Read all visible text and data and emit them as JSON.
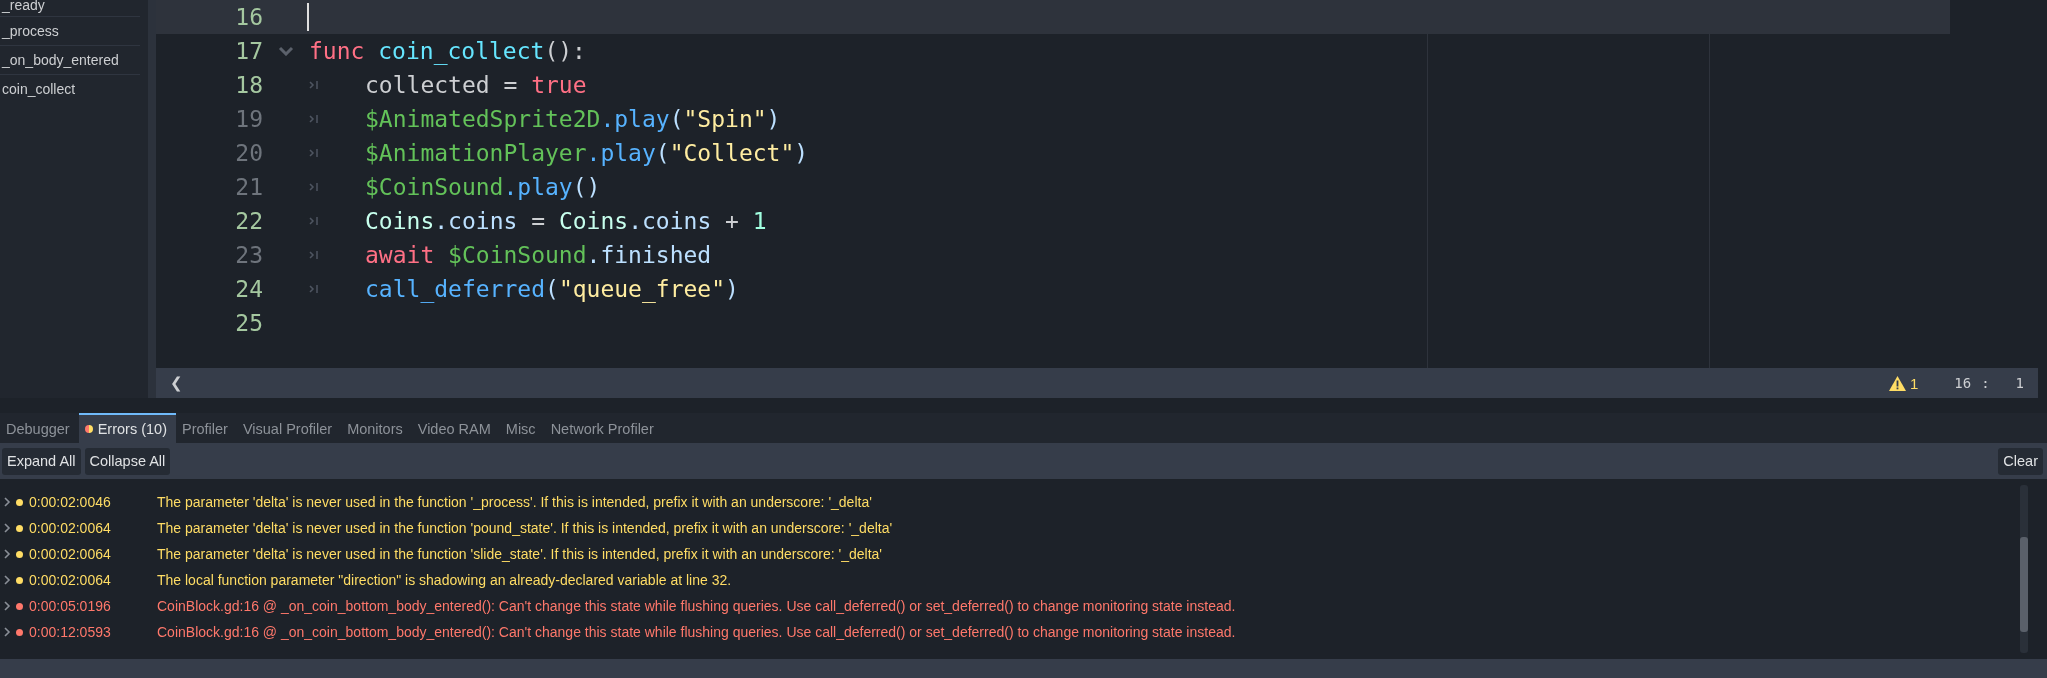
{
  "sidebar": {
    "items": [
      {
        "label": "_ready",
        "selected": false
      },
      {
        "label": "_process",
        "selected": false
      },
      {
        "label": "_on_body_entered",
        "selected": false
      },
      {
        "label": "coin_collect",
        "selected": false
      }
    ]
  },
  "editor": {
    "lines": [
      {
        "number": "16",
        "current": true,
        "highlighted_number": true,
        "foldable": false,
        "indent": false
      },
      {
        "number": "17",
        "current": false,
        "highlighted_number": true,
        "foldable": true,
        "indent": false,
        "tokens": [
          {
            "kind": "keyword",
            "text": "func "
          },
          {
            "kind": "function",
            "text": "coin_collect"
          },
          {
            "kind": "plain",
            "text": "():"
          }
        ]
      },
      {
        "number": "18",
        "current": false,
        "highlighted_number": true,
        "foldable": false,
        "indent": true,
        "tokens": [
          {
            "kind": "plain",
            "text": "collected = "
          },
          {
            "kind": "keyword",
            "text": "true"
          }
        ]
      },
      {
        "number": "19",
        "current": false,
        "highlighted_number": false,
        "foldable": false,
        "indent": true,
        "tokens": [
          {
            "kind": "node",
            "text": "$AnimatedSprite2D"
          },
          {
            "kind": "method",
            "text": ".play"
          },
          {
            "kind": "member",
            "text": "("
          },
          {
            "kind": "string",
            "text": "\"Spin\""
          },
          {
            "kind": "member",
            "text": ")"
          }
        ]
      },
      {
        "number": "20",
        "current": false,
        "highlighted_number": false,
        "foldable": false,
        "indent": true,
        "tokens": [
          {
            "kind": "node",
            "text": "$AnimationPlayer"
          },
          {
            "kind": "method",
            "text": ".play"
          },
          {
            "kind": "member",
            "text": "("
          },
          {
            "kind": "string",
            "text": "\"Collect\""
          },
          {
            "kind": "member",
            "text": ")"
          }
        ]
      },
      {
        "number": "21",
        "current": false,
        "highlighted_number": false,
        "foldable": false,
        "indent": true,
        "tokens": [
          {
            "kind": "node",
            "text": "$CoinSound"
          },
          {
            "kind": "method",
            "text": ".play"
          },
          {
            "kind": "member",
            "text": "()"
          }
        ]
      },
      {
        "number": "22",
        "current": false,
        "highlighted_number": true,
        "foldable": false,
        "indent": true,
        "tokens": [
          {
            "kind": "global",
            "text": "Coins"
          },
          {
            "kind": "member",
            "text": ".coins"
          },
          {
            "kind": "plain",
            "text": " = "
          },
          {
            "kind": "global",
            "text": "Coins"
          },
          {
            "kind": "member",
            "text": ".coins"
          },
          {
            "kind": "plain",
            "text": " + "
          },
          {
            "kind": "number",
            "text": "1"
          }
        ]
      },
      {
        "number": "23",
        "current": false,
        "highlighted_number": false,
        "foldable": false,
        "indent": true,
        "tokens": [
          {
            "kind": "keyword",
            "text": "await "
          },
          {
            "kind": "node",
            "text": "$CoinSound"
          },
          {
            "kind": "member",
            "text": ".finished"
          }
        ]
      },
      {
        "number": "24",
        "current": false,
        "highlighted_number": true,
        "foldable": false,
        "indent": true,
        "tokens": [
          {
            "kind": "method",
            "text": "call_deferred"
          },
          {
            "kind": "member",
            "text": "("
          },
          {
            "kind": "string",
            "text": "\"queue_free\""
          },
          {
            "kind": "member",
            "text": ")"
          }
        ]
      },
      {
        "number": "25",
        "current": false,
        "highlighted_number": true,
        "foldable": false,
        "indent": false
      }
    ]
  },
  "status_bar": {
    "back": "❮",
    "warnings": "1",
    "line": "16",
    "separator": ":",
    "column": "1"
  },
  "tabs": [
    {
      "label": "Debugger",
      "selected": false,
      "dot": false
    },
    {
      "label": "Errors (10)",
      "selected": true,
      "dot": true
    },
    {
      "label": "Profiler",
      "selected": false,
      "dot": false
    },
    {
      "label": "Visual Profiler",
      "selected": false,
      "dot": false
    },
    {
      "label": "Monitors",
      "selected": false,
      "dot": false
    },
    {
      "label": "Video RAM",
      "selected": false,
      "dot": false
    },
    {
      "label": "Misc",
      "selected": false,
      "dot": false
    },
    {
      "label": "Network Profiler",
      "selected": false,
      "dot": false
    }
  ],
  "toolbar": {
    "buttons": [
      "Expand All",
      "Collapse All"
    ],
    "clear": "Clear"
  },
  "errors": [
    {
      "kind": "warning",
      "time": "0:00:02:0046",
      "message": "The parameter 'delta' is never used in the function '_process'. If this is intended, prefix it with an underscore: '_delta'"
    },
    {
      "kind": "warning",
      "time": "0:00:02:0064",
      "message": "The parameter 'delta' is never used in the function 'pound_state'. If this is intended, prefix it with an underscore: '_delta'"
    },
    {
      "kind": "warning",
      "time": "0:00:02:0064",
      "message": "The parameter 'delta' is never used in the function 'slide_state'. If this is intended, prefix it with an underscore: '_delta'"
    },
    {
      "kind": "warning",
      "time": "0:00:02:0064",
      "message": "The local function parameter \"direction\" is shadowing an already-declared variable at line 32."
    },
    {
      "kind": "error",
      "time": "0:00:05:0196",
      "message": "CoinBlock.gd:16 @ _on_coin_bottom_body_entered(): Can't change this state while flushing queries. Use call_deferred() or set_deferred() to change monitoring state instead."
    },
    {
      "kind": "error",
      "time": "0:00:12:0593",
      "message": "CoinBlock.gd:16 @ _on_coin_bottom_body_entered(): Can't change this state while flushing queries. Use call_deferred() or set_deferred() to change monitoring state instead."
    }
  ]
}
